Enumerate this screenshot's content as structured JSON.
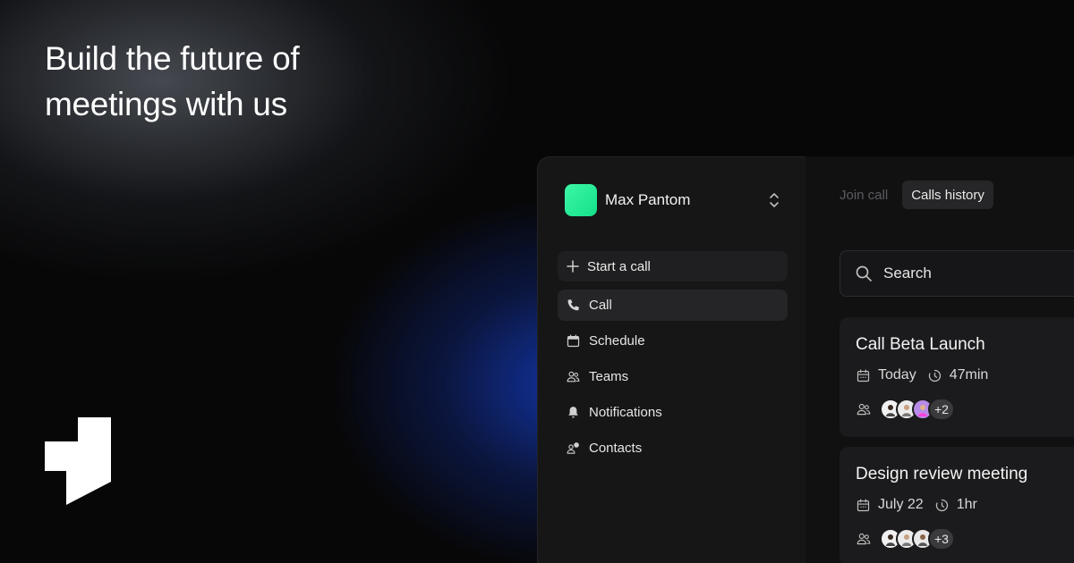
{
  "hero": {
    "headline_line1": "Build the future of",
    "headline_line2": "meetings with us"
  },
  "sidebar": {
    "account_name": "Max Pantom",
    "account_color": "#1ef096",
    "start_call_label": "Start a call",
    "items": [
      {
        "label": "Call",
        "icon": "phone-icon",
        "active": true
      },
      {
        "label": "Schedule",
        "icon": "calendar-icon",
        "active": false
      },
      {
        "label": "Teams",
        "icon": "users-icon",
        "active": false
      },
      {
        "label": "Notifications",
        "icon": "bell-icon",
        "active": false
      },
      {
        "label": "Contacts",
        "icon": "contacts-icon",
        "active": false
      }
    ]
  },
  "main": {
    "tabs": [
      {
        "label": "Join call",
        "active": false
      },
      {
        "label": "Calls history",
        "active": true
      }
    ],
    "search_placeholder": "Search",
    "calls": [
      {
        "title": "Call Beta Launch",
        "date": "Today",
        "duration": "47min",
        "extra_participants": "+2"
      },
      {
        "title": "Design review meeting",
        "date": "July 22",
        "duration": "1hr",
        "extra_participants": "+3"
      }
    ]
  },
  "colors": {
    "accent_green": "#1ef096",
    "background": "#070708",
    "glow_blue": "#1434b4"
  }
}
